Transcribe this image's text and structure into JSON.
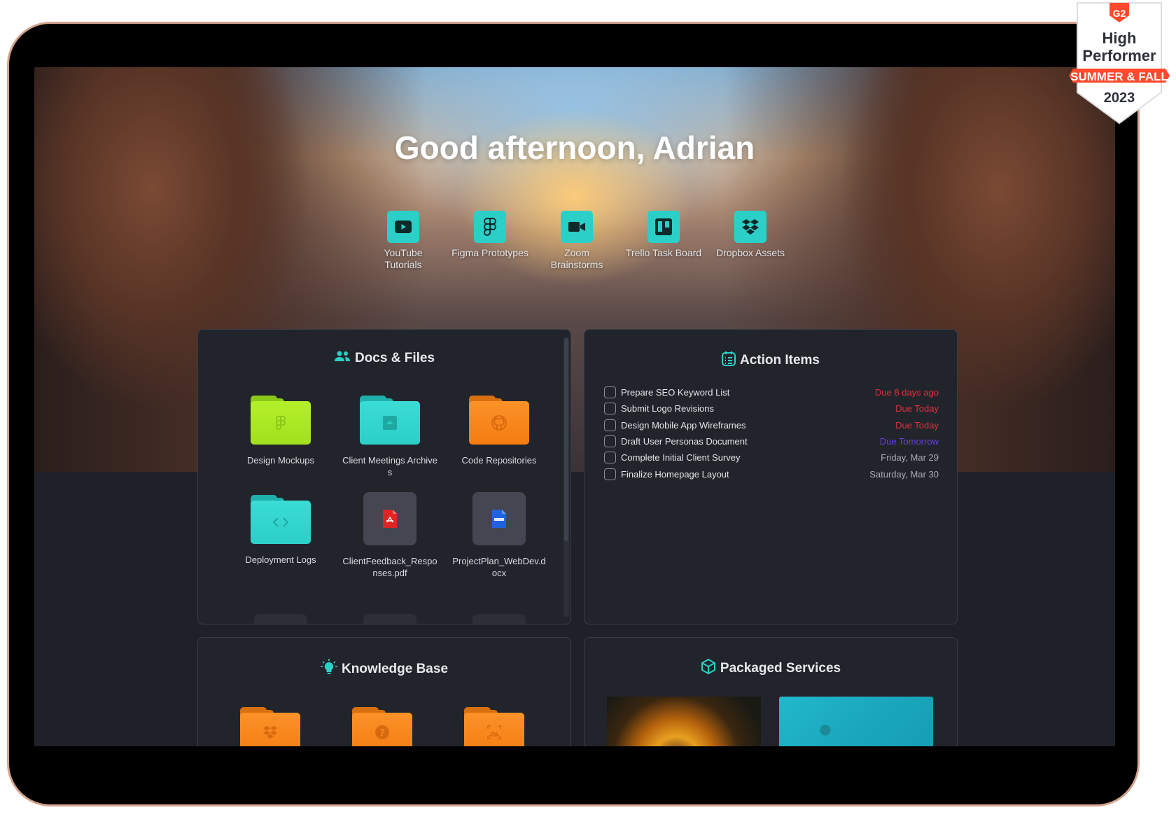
{
  "greeting": "Good afternoon, Adrian",
  "shortcuts": [
    {
      "label": "YouTube Tutorials",
      "icon": "youtube-icon"
    },
    {
      "label": "Figma Prototypes",
      "icon": "figma-icon"
    },
    {
      "label": "Zoom Brainstorms",
      "icon": "video-camera-icon"
    },
    {
      "label": "Trello Task Board",
      "icon": "trello-icon"
    },
    {
      "label": "Dropbox Assets",
      "icon": "dropbox-icon"
    }
  ],
  "docs": {
    "title": "Docs & Files",
    "icon": "people-icon",
    "items": [
      {
        "label": "Design Mockups",
        "type": "folder",
        "color": "#a6e22a",
        "icon": "figma-icon"
      },
      {
        "label": "Client Meetings Archives",
        "type": "folder",
        "color": "#2fd1cb",
        "icon": "archive-icon"
      },
      {
        "label": "Code Repositories",
        "type": "folder",
        "color": "#f7861c",
        "icon": "github-icon"
      },
      {
        "label": "Deployment Logs",
        "type": "folder",
        "color": "#2fd1cb",
        "icon": "code-icon"
      },
      {
        "label": "ClientFeedback_Responses.pdf",
        "type": "file",
        "icon": "pdf-icon"
      },
      {
        "label": "ProjectPlan_WebDev.docx",
        "type": "file",
        "icon": "doc-icon"
      }
    ]
  },
  "actions": {
    "title": "Action Items",
    "icon": "checklist-icon",
    "items": [
      {
        "label": "Prepare SEO Keyword List",
        "due": "Due 8 days ago",
        "color": "#e0303c"
      },
      {
        "label": "Submit Logo Revisions",
        "due": "Due Today",
        "color": "#e0303c"
      },
      {
        "label": "Design Mobile App Wireframes",
        "due": "Due Today",
        "color": "#e0303c"
      },
      {
        "label": "Draft User Personas Document",
        "due": "Due Tomorrow",
        "color": "#6a3fe0"
      },
      {
        "label": "Complete Initial Client Survey",
        "due": "Friday, Mar 29",
        "color": "#a9abb3"
      },
      {
        "label": "Finalize Homepage Layout",
        "due": "Saturday, Mar 30",
        "color": "#a9abb3"
      }
    ]
  },
  "knowledge": {
    "title": "Knowledge Base",
    "icon": "lightbulb-icon",
    "folders": [
      {
        "icon": "dropbox-icon",
        "color": "#f7861c"
      },
      {
        "icon": "help-icon",
        "color": "#f7861c"
      },
      {
        "icon": "image-icon",
        "color": "#f7861c"
      }
    ]
  },
  "packaged": {
    "title": "Packaged Services",
    "icon": "box-icon",
    "images": [
      "spiral-staircase-image",
      "teal-flatlay-image"
    ]
  },
  "badge": {
    "brand": "G2",
    "line1": "High",
    "line2": "Performer",
    "ribbon": "SUMMER & FALL",
    "year": "2023"
  },
  "colors": {
    "accent": "#2ccfc7",
    "panel": "#22242b",
    "background": "#1f2128",
    "overdue": "#e0303c",
    "tomorrow": "#6a3fe0",
    "badge_red": "#ff492c"
  }
}
